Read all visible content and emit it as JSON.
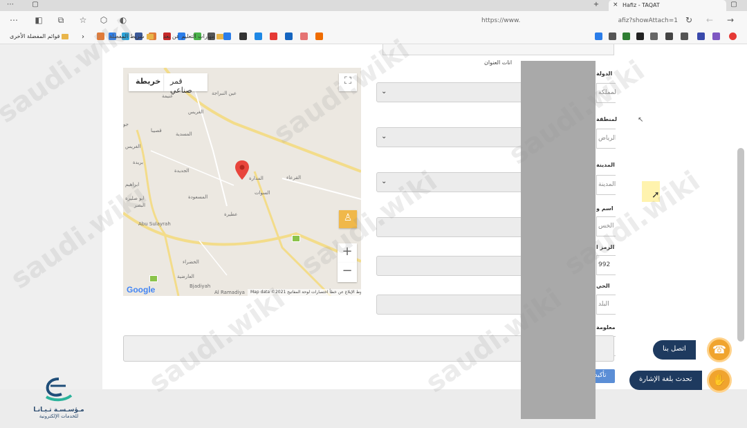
{
  "browser": {
    "tab_title": "Hafiz - TAQAT",
    "url_left": "https://www.",
    "url_right": "afiz?showAttach=1",
    "bookmarks": {
      "other_favorites": "قوائم المفضلة الأخرى",
      "favorites_bar": "شريط المفضلة",
      "remote_learning": "مهارات التعليم عن بعد"
    }
  },
  "form": {
    "address_hint": "انات العنوان",
    "labels": {
      "country": "الدولة",
      "region": "المنطقة",
      "city": "المدينة",
      "building_name": "اسم و",
      "postal_code": "الرمز ا",
      "district": "الحي",
      "information": "معلومة"
    },
    "values": {
      "country": "المملكة",
      "region": "الرياض",
      "city": "المدينة",
      "building_name": "الخس",
      "postal_code": "992",
      "district": "البلد"
    },
    "confirm_label": "تأكيد"
  },
  "map": {
    "toggle_satellite": "قمر صناعي",
    "toggle_map": "خريطة",
    "zoom_in": "+",
    "zoom_out": "−",
    "google_logo": "Google",
    "attribution": "Map data ©2021   الشروط   الإبلاغ عن خطأ   اختصارات لوحة المفاتيح",
    "places": [
      "غنيمة",
      "عين النبراجة",
      "الغريس",
      "قصيبا",
      "المسدية",
      "الغريس",
      "بريدة",
      "ابراهيم",
      "الجديدة",
      "المسعودة",
      "القرعاء",
      "السوات",
      "ابو صليرة",
      "البصر",
      "عطيرة",
      "الخضراء",
      "العارضية",
      "Abu Sulayrah",
      "Bjadiyah",
      "Al Ramadiya",
      "المدارة",
      "أفيراء",
      "جو"
    ]
  },
  "help": {
    "contact_us": "اتصل بنا",
    "sign_language": "تحدث بلغة الإشارة"
  },
  "logo": {
    "line1": "مـؤسـسـة تـيـانـا",
    "line2": "للخدمات الإلكترونية"
  },
  "watermark": "saudi.wiki",
  "colors": {
    "help_button": "#1e3a5f",
    "help_circle": "#f0a42e",
    "confirm": "#5b8ed6",
    "map_pin": "#e8453c"
  }
}
